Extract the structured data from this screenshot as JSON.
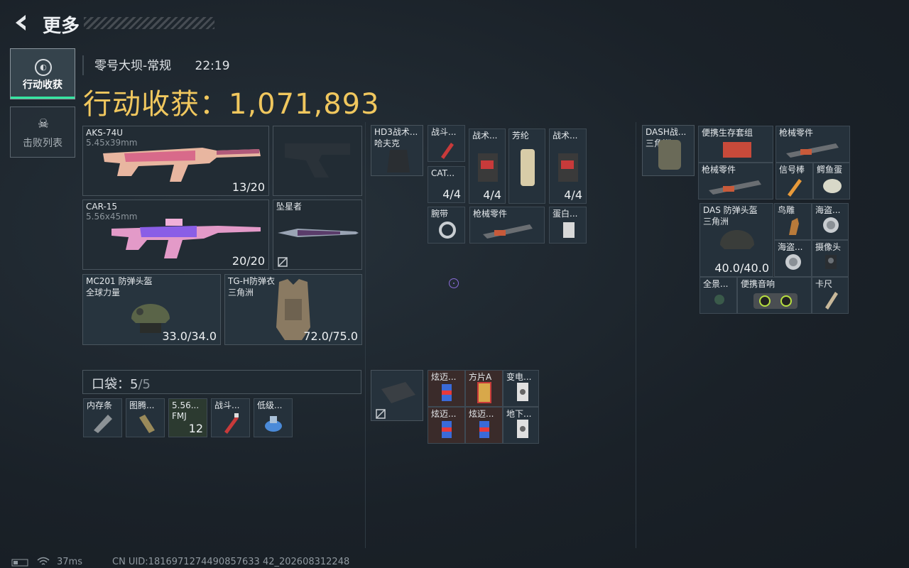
{
  "header": {
    "back_icon": "back-arrow-icon",
    "title": "更多"
  },
  "tabs": [
    {
      "label": "行动收获",
      "icon": "loot-icon",
      "active": true
    },
    {
      "label": "击败列表",
      "icon": "skull-icon",
      "active": false
    }
  ],
  "match": {
    "map": "零号大坝-常规",
    "duration": "22:19"
  },
  "loot_total": "行动收获：1,071,893",
  "equipment": {
    "primary": {
      "name": "AKS-74U",
      "ammo": "5.45x39mm",
      "count": "13/20"
    },
    "secondary": {
      "name": "CAR-15",
      "ammo": "5.56x45mm",
      "count": "20/20"
    },
    "sidearm": {
      "name": ""
    },
    "melee": {
      "name": "坠星者"
    },
    "helmet": {
      "name": "MC201 防弹头盔",
      "origin": "全球力量",
      "durability": "33.0/34.0"
    },
    "armor": {
      "name": "TG-H防弹衣",
      "origin": "三角洲",
      "durability": "72.0/75.0"
    }
  },
  "pocket": {
    "label": "口袋：",
    "used": "5",
    "total": "/5",
    "items": [
      {
        "name": "内存条"
      },
      {
        "name": "图腾..."
      },
      {
        "name": "5.56... FMJ",
        "count": "12"
      },
      {
        "name": "战斗..."
      },
      {
        "name": "低级..."
      }
    ]
  },
  "chest_rig": {
    "name": "HD3战术...",
    "origin": "哈夫克",
    "items": [
      {
        "name": "战斗..."
      },
      {
        "name": "战术...",
        "count": "4/4"
      },
      {
        "name": "芳纶"
      },
      {
        "name": "战术...",
        "count": "4/4"
      },
      {
        "name": "CAT...",
        "count": "4/4"
      },
      {
        "name": "腕带"
      },
      {
        "name": "枪械零件"
      },
      {
        "name": "蛋白..."
      }
    ]
  },
  "safe_box": {
    "items": [
      {
        "name": "炫迈..."
      },
      {
        "name": "方片A"
      },
      {
        "name": "变电..."
      },
      {
        "name": "炫迈..."
      },
      {
        "name": "炫迈..."
      },
      {
        "name": "地下..."
      }
    ]
  },
  "backpack": {
    "name": "DASH战...",
    "origin": "三角洲",
    "items": [
      {
        "name": "便携生存套组"
      },
      {
        "name": "枪械零件"
      },
      {
        "name": "枪械零件"
      },
      {
        "name": "信号棒"
      },
      {
        "name": "鳄鱼蛋"
      },
      {
        "name": "DAS 防弹头盔",
        "origin": "三角洲",
        "durability": "40.0/40.0"
      },
      {
        "name": "鸟雕"
      },
      {
        "name": "海盗..."
      },
      {
        "name": "海盗..."
      },
      {
        "name": "摄像头"
      },
      {
        "name": "全景..."
      },
      {
        "name": "便携音响"
      },
      {
        "name": "卡尺"
      }
    ]
  },
  "footer": {
    "ping": "37ms",
    "uid": "CN UID:1816971274490857633 42_202608312248"
  },
  "colors": {
    "accent": "#33e6a0",
    "gold": "#f0c75e",
    "red_rarity": "#3a2b2a"
  }
}
